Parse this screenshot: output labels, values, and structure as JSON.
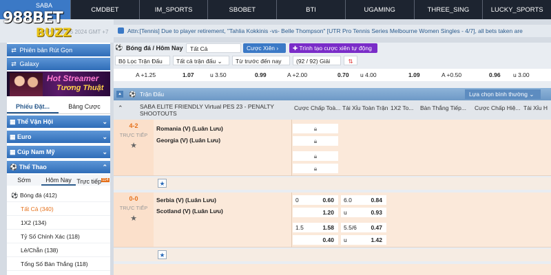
{
  "topnav": {
    "brand_tab": "SABA",
    "tabs": [
      "CMDBET",
      "IM_SPORTS",
      "SBOBET",
      "BTI",
      "UGAMING",
      "THREE_SING",
      "LUCKY_SPORTS"
    ]
  },
  "logo": {
    "text_988": "988",
    "text_bet": "BET",
    "text_buzz": "BUZZ"
  },
  "timebar": {
    "text": "58PM July05 2024 GMT +7"
  },
  "marquee": {
    "text": "Attn:[Tennis] Due to player retirement, \"Tahlia Kokkinis -vs- Belle Thompson\" [UTR Pro Tennis Series Melbourne Women Singles - 4/7], all bets taken are"
  },
  "sidebar": {
    "btn_classic": "Phiên bản Rút Gọn",
    "btn_galaxy": "Galaxy",
    "banner": {
      "line1": "Hot Streamer",
      "line2": "Tương Thuật"
    },
    "tabs": [
      "Phiếu Đặt...",
      "Bảng Cược"
    ],
    "categories": [
      "Thể Vận Hội",
      "Euro",
      "Cúp Nam Mỹ",
      "Thể Thao"
    ],
    "subtabs": [
      "Sớm",
      "Hôm Nay",
      "Trực tiếp"
    ],
    "live_count": "114",
    "items": [
      {
        "label": "Bóng đá",
        "count": "(412)"
      },
      {
        "label": "Tất Cả",
        "count": "(340)"
      },
      {
        "label": "1X2",
        "count": "(134)"
      },
      {
        "label": "Tỷ Số Chính Xác",
        "count": "(118)"
      },
      {
        "label": "Lẻ/Chẵn",
        "count": "(138)"
      },
      {
        "label": "Tổng Số Bàn Thắng",
        "count": "(118)"
      }
    ]
  },
  "toolbar": {
    "title": "Bóng đá / Hôm Nay",
    "all": "Tất Cả",
    "parlay": "Cược Xiên",
    "create_parlay": "Trình tạo cược xiên tự động"
  },
  "filters": {
    "league": "Bộ Lọc Trận Đấu",
    "all_matches": "Tất cả trận đấu",
    "sort": "Từ trước đến nay",
    "count": "(92 / 92) Giải"
  },
  "odds_strip": [
    {
      "hdp": "A +1.25",
      "hdp_odds": "1.07",
      "ou": "u 3.50",
      "ou_odds": "0.99"
    },
    {
      "hdp": "A +2.00",
      "hdp_odds": "0.70",
      "ou": "u 4.00",
      "ou_odds": "1.09"
    },
    {
      "hdp": "A +0.50",
      "hdp_odds": "0.96",
      "ou": "u 3.00",
      "ou_odds": ""
    }
  ],
  "section": {
    "title": "Trận Đấu",
    "view_select": "Lựa chọn bình thường"
  },
  "league": {
    "name": "SABA ELITE FRIENDLY Virtual PES 23 - PENALTY SHOOTOUTS"
  },
  "columns": [
    "Cược Chấp Toà...",
    "Tài Xỉu Toàn Trận",
    "1X2 To...",
    "Bàn Thắng Tiếp...",
    "Cược Chấp Hiệ...",
    "Tài Xỉu H"
  ],
  "matches": [
    {
      "score": "4-2",
      "status": "TRỰC TIẾP",
      "home": "Romania (V) (Luân Lưu)",
      "away": "Georgia (V) (Luân Lưu)"
    },
    {
      "score": "0-0",
      "status": "TRỰC TIẾP",
      "home": "Serbia (V) (Luân Lưu)",
      "away": "Scotland (V) (Luân Lưu)",
      "odds": [
        {
          "hdp": "0",
          "hdp_odds": "0.60",
          "ou": "6.0",
          "ou_odds": "0.84"
        },
        {
          "hdp": "",
          "hdp_odds": "1.20",
          "ou": "u",
          "ou_odds": "0.93"
        },
        {
          "hdp": "1.5",
          "hdp_odds": "1.58",
          "ou": "5.5/6",
          "ou_odds": "0.47"
        },
        {
          "hdp": "",
          "hdp_odds": "0.40",
          "ou": "u",
          "ou_odds": "1.42"
        }
      ]
    }
  ]
}
